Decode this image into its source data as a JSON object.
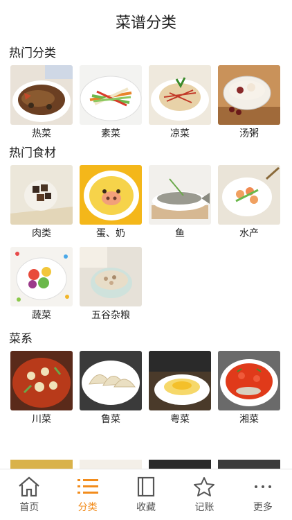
{
  "header": {
    "title": "菜谱分类"
  },
  "sections": [
    {
      "title": "热门分类",
      "items": [
        {
          "label": "热菜"
        },
        {
          "label": "素菜"
        },
        {
          "label": "凉菜"
        },
        {
          "label": "汤粥"
        }
      ]
    },
    {
      "title": "热门食材",
      "items": [
        {
          "label": "肉类"
        },
        {
          "label": "蛋、奶"
        },
        {
          "label": "鱼"
        },
        {
          "label": "水产"
        },
        {
          "label": "蔬菜"
        },
        {
          "label": "五谷杂粮"
        }
      ]
    },
    {
      "title": "菜系",
      "items": [
        {
          "label": "川菜"
        },
        {
          "label": "鲁菜"
        },
        {
          "label": "粤菜"
        },
        {
          "label": "湘菜"
        }
      ]
    }
  ],
  "tabbar": {
    "items": [
      {
        "label": "首页",
        "icon": "home-icon"
      },
      {
        "label": "分类",
        "icon": "list-icon"
      },
      {
        "label": "收藏",
        "icon": "bookmark-icon"
      },
      {
        "label": "记账",
        "icon": "star-icon"
      },
      {
        "label": "更多",
        "icon": "more-icon"
      }
    ],
    "active_color": "#f28c1c",
    "inactive_color": "#555555"
  }
}
